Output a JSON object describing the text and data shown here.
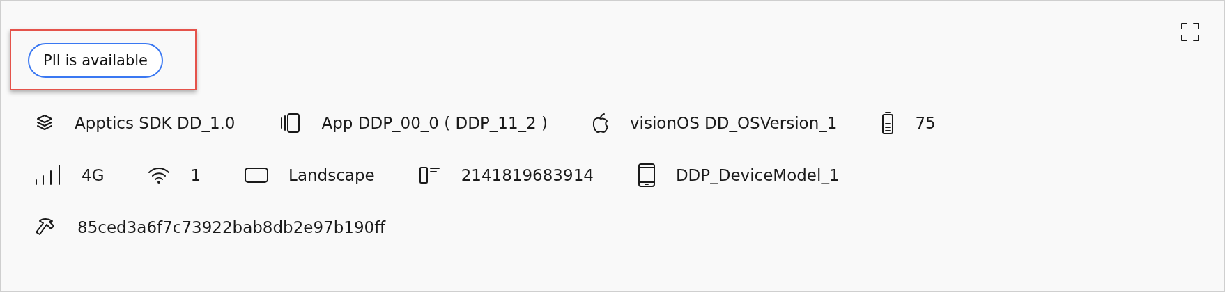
{
  "badge": {
    "label": "PII is available",
    "highlighted": true
  },
  "rows": [
    [
      {
        "kind": "sdk",
        "text": "Apptics SDK DD_1.0"
      },
      {
        "kind": "app",
        "text": "App DDP_00_0 ( DDP_11_2 )"
      },
      {
        "kind": "os",
        "text": "visionOS DD_OSVersion_1"
      },
      {
        "kind": "battery",
        "text": "75"
      }
    ],
    [
      {
        "kind": "network",
        "text": "4G"
      },
      {
        "kind": "wifi",
        "text": "1"
      },
      {
        "kind": "orientation",
        "text": "Landscape"
      },
      {
        "kind": "device-id",
        "text": "2141819683914"
      },
      {
        "kind": "device",
        "text": "DDP_DeviceModel_1"
      }
    ],
    [
      {
        "kind": "build",
        "text": "85ced3a6f7c73922bab8db2e97b190ff"
      }
    ]
  ]
}
